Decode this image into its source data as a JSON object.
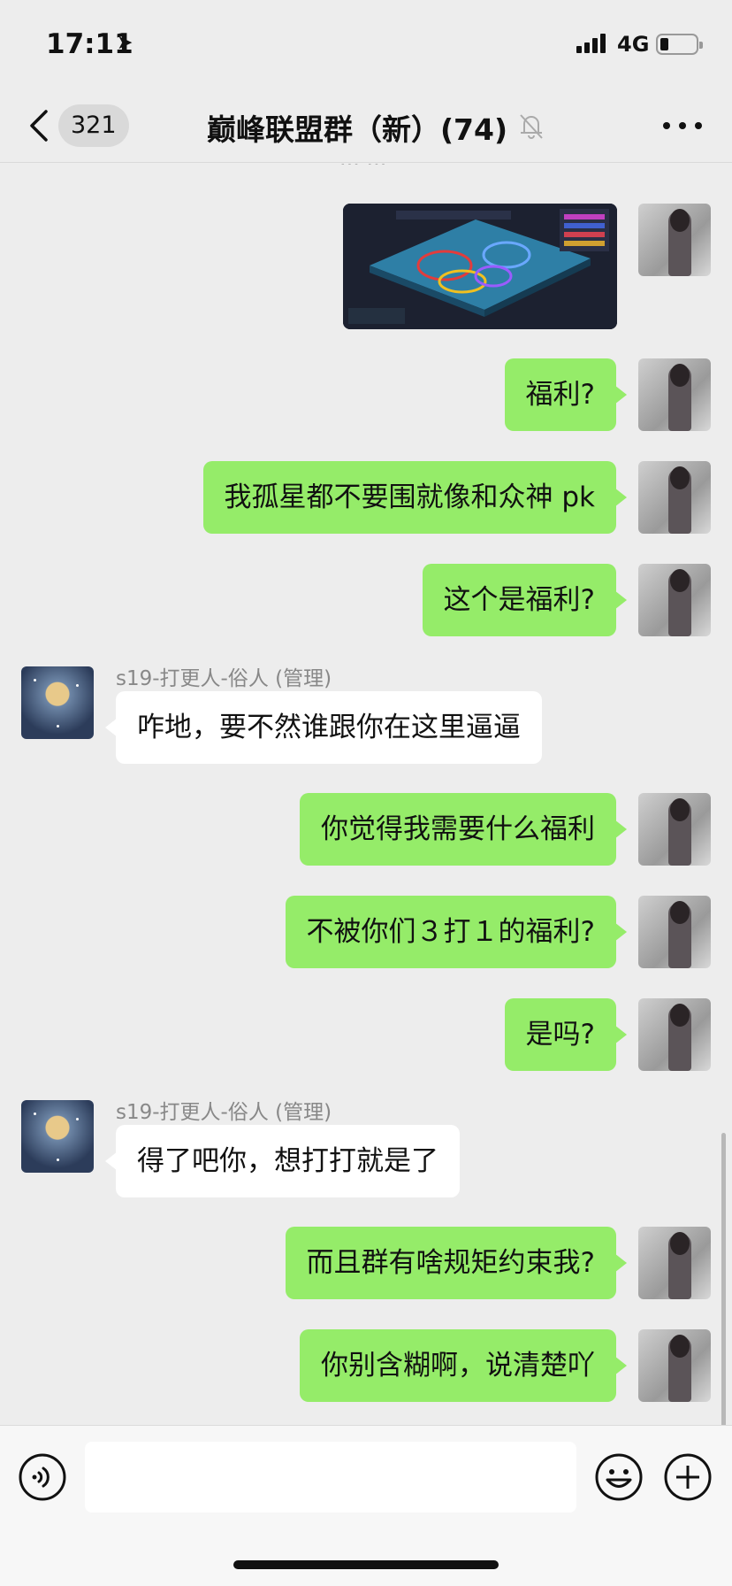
{
  "status_bar": {
    "time": "17:11",
    "network": "4G"
  },
  "nav": {
    "back_count": "321",
    "title": "巅峰联盟群（新）(74)"
  },
  "chat": {
    "partial_time": "··· ···",
    "messages": [
      {
        "from": "me",
        "type": "image"
      },
      {
        "from": "me",
        "text": "福利?"
      },
      {
        "from": "me",
        "text": "我孤星都不要围就像和众神 pk"
      },
      {
        "from": "me",
        "text": "这个是福利?"
      },
      {
        "from": "other",
        "sender": "s19-打更人-俗人 (管理)",
        "text": "咋地，要不然谁跟你在这里逼逼"
      },
      {
        "from": "me",
        "text": "你觉得我需要什么福利"
      },
      {
        "from": "me",
        "text": "不被你们３打１的福利?"
      },
      {
        "from": "me",
        "text": "是吗?"
      },
      {
        "from": "other",
        "sender": "s19-打更人-俗人 (管理)",
        "text": "得了吧你，想打打就是了"
      },
      {
        "from": "me",
        "text": "而且群有啥规矩约束我?"
      },
      {
        "from": "me",
        "text": "你别含糊啊，说清楚吖"
      }
    ]
  },
  "input": {
    "placeholder": ""
  },
  "colors": {
    "my_bubble": "#95ec69",
    "other_bubble": "#ffffff",
    "background": "#ededed"
  }
}
